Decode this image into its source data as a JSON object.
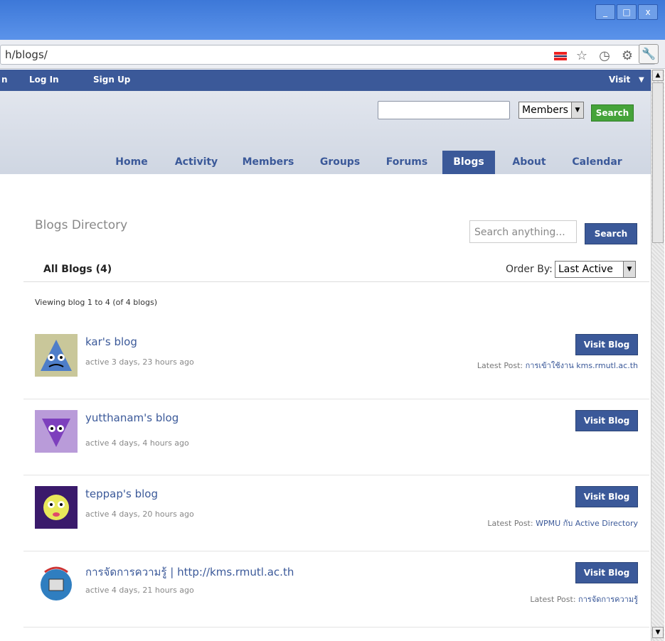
{
  "window": {
    "minimize": "_",
    "maximize": "□",
    "close": "x"
  },
  "browser": {
    "url": "h/blogs/",
    "flag_icon": "thai-flag-icon",
    "star_icon": "star-icon",
    "history_icon": "history-icon",
    "gear_icon": "gear-icon",
    "wrench_icon": "wrench-icon"
  },
  "adminbar": {
    "items": [
      "n",
      "Log In",
      "Sign Up"
    ],
    "visit": "Visit"
  },
  "header": {
    "search_value": "",
    "select_value": "Members",
    "search_btn": "Search"
  },
  "nav": [
    "Home",
    "Activity",
    "Members",
    "Groups",
    "Forums",
    "Blogs",
    "About",
    "Calendar"
  ],
  "directory": {
    "title": "Blogs Directory",
    "search_placeholder": "Search anything...",
    "search_btn": "Search",
    "tab": "All Blogs (4)",
    "order_label": "Order By:",
    "order_value": "Last Active",
    "viewing": "Viewing blog 1 to 4 (of 4 blogs)"
  },
  "blogs": [
    {
      "name": "kar's blog",
      "active": "active 3 days, 23 hours ago",
      "btn": "Visit Blog",
      "latest_label": "Latest Post:",
      "latest_link": "การเข้าใช้งาน kms.rmutl.ac.th"
    },
    {
      "name": "yutthanam's blog",
      "active": "active 4 days, 4 hours ago",
      "btn": "Visit Blog",
      "latest_label": "",
      "latest_link": ""
    },
    {
      "name": "teppap's blog",
      "active": "active 4 days, 20 hours ago",
      "btn": "Visit Blog",
      "latest_label": "Latest Post:",
      "latest_link": "WPMU กับ Active Directory"
    },
    {
      "name": "การจัดการความรู้ | http://kms.rmutl.ac.th",
      "active": "active 4 days, 21 hours ago",
      "btn": "Visit Blog",
      "latest_label": "Latest Post:",
      "latest_link": "การจัดการความรู้"
    }
  ]
}
